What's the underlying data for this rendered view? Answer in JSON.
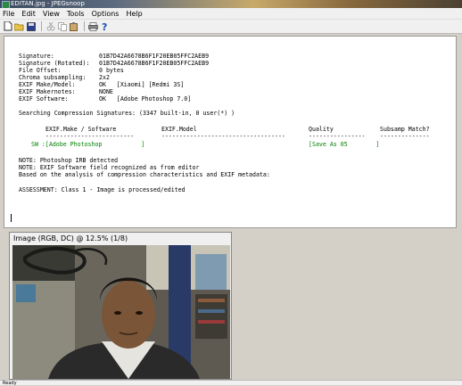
{
  "window": {
    "title": "EDITAN.jpg - JPEGsnoop"
  },
  "menu": [
    "File",
    "Edit",
    "View",
    "Tools",
    "Options",
    "Help"
  ],
  "toolbar_icons": [
    "new-icon",
    "open-icon",
    "save-icon",
    "cut-icon",
    "copy-icon",
    "paste-icon",
    "print-icon",
    "help-icon"
  ],
  "report": {
    "signature_label": "Signature:",
    "signature_value": "01B7D42A6678B6F1F20EB05FFC2AEB9",
    "signature_rot_label": "Signature (Rotated):",
    "signature_rot_value": "01B7D42A6678B6F1F20EB05FFC2AEB9",
    "file_offset_label": "File Offset:",
    "file_offset_value": "0 bytes",
    "chroma_label": "Chroma subsampling:",
    "chroma_value": "2x2",
    "make_label": "EXIF Make/Model:",
    "make_value": "OK   [Xiaomi] [Redmi 3S]",
    "makernotes_label": "EXIF Makernotes:",
    "makernotes_value": "NONE",
    "software_label": "EXIF Software:",
    "software_value": "OK   [Adobe Photoshop 7.0]",
    "searching": "Searching Compression Signatures: (3347 built-in, 0 user(*) )",
    "col_make": "EXIF.Make / Software",
    "col_model": "EXIF.Model",
    "col_quality": "Quality",
    "col_subsamp": "Subsamp Match?",
    "dash_make": "-------------------------",
    "dash_model": "-----------------------------------",
    "dash_quality": "----------------",
    "dash_subsamp": "--------------",
    "sw_row": "SW :[Adobe Photoshop           ]",
    "sw_quality": "[Save As 05        ]",
    "note1": "NOTE: Photoshop IRB detected",
    "note2": "NOTE: EXIF Software field recognized as from editor",
    "based": "Based on the analysis of compression characteristics and EXIF metadata:",
    "assessment": "ASSESSMENT: Class 1 - Image is processed/edited"
  },
  "image_panel": {
    "caption": "Image (RGB, DC) @ 12.5% (1/8)"
  },
  "status": {
    "text": "Ready"
  }
}
